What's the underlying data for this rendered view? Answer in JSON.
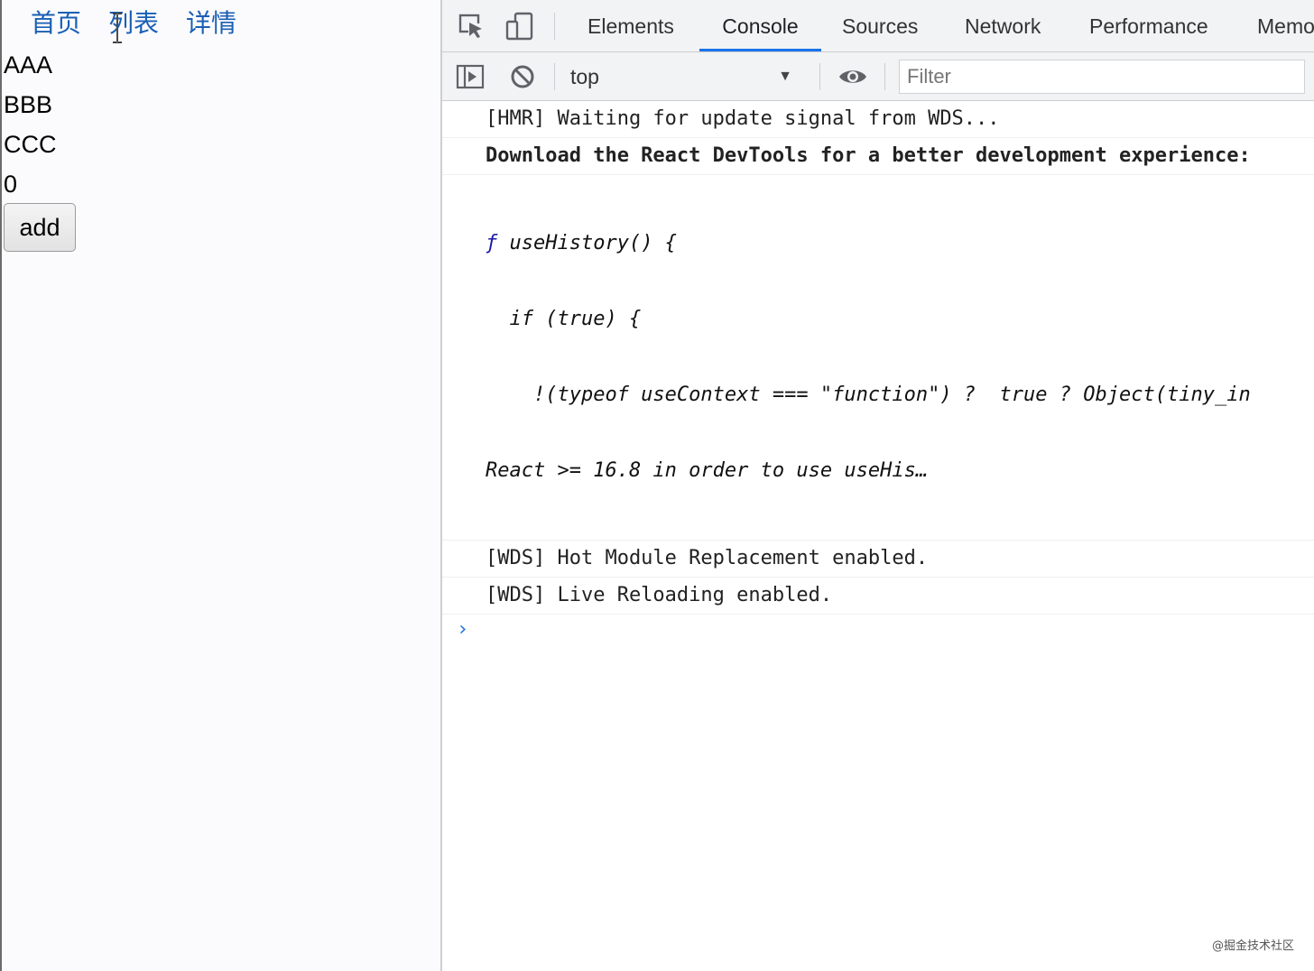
{
  "page": {
    "nav": [
      {
        "label": "首页"
      },
      {
        "label": "列表"
      },
      {
        "label": "详情"
      }
    ],
    "items": [
      "AAA",
      "BBB",
      "CCC"
    ],
    "count": "0",
    "add_button_label": "add"
  },
  "devtools": {
    "tabs": [
      {
        "label": "Elements"
      },
      {
        "label": "Console",
        "active": true
      },
      {
        "label": "Sources"
      },
      {
        "label": "Network"
      },
      {
        "label": "Performance"
      },
      {
        "label": "Memo"
      }
    ],
    "toolbar": {
      "context": "top",
      "filter_placeholder": "Filter"
    },
    "console_messages": {
      "hmr": "[HMR] Waiting for update signal from WDS...",
      "react_devtools": "Download the React DevTools for a better development experience:",
      "fn_line1_name": "useHistory() {",
      "fn_line2": "  if (true) {",
      "fn_line3": "    !(typeof useContext === \"function\") ?  true ? Object(tiny_in",
      "fn_line4": "React >= 16.8 in order to use useHis…",
      "wds_hmr": "[WDS] Hot Module Replacement enabled.",
      "wds_live": "[WDS] Live Reloading enabled."
    },
    "prompt_symbol": "›"
  },
  "watermark": "@掘金技术社区",
  "icons": {
    "inspect": "inspect-element-icon",
    "device": "device-toolbar-icon",
    "sidebar": "console-sidebar-icon",
    "clear": "clear-console-icon",
    "eye": "live-expression-icon"
  },
  "colors": {
    "link": "#1a5fb4",
    "active_tab": "#1a73e8",
    "toolbar_bg": "#f1f3f4"
  }
}
